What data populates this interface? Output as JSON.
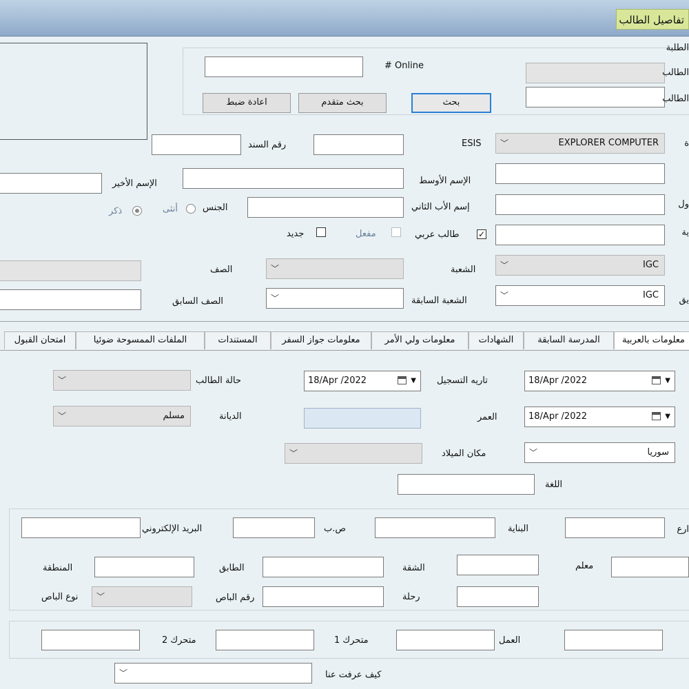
{
  "window": {
    "title": "تفاصيل الطالب"
  },
  "search": {
    "group_label": "الطلبة",
    "online_label": "# Online",
    "online_value": "",
    "student_no_label": "الطالب",
    "student_name_label": "الطالب",
    "search_button": "بحث",
    "advanced_search_button": "بحث متقدم",
    "reset_button": "اعادة ضبط"
  },
  "form": {
    "school_label": "ة",
    "school_value": "EXPLORER COMPUTER",
    "esis_label": "ESIS",
    "esis_value": "",
    "receipt_no_label": "رقم السند",
    "receipt_no_value": "",
    "first_name_label": "",
    "middle_name_label": "الإسم الأوسط",
    "last_name_label": "الإسم الأخير",
    "first_name_label_cut": "ول",
    "second_father_label": "إسم الأب الثاني",
    "gender_label": "الجنس",
    "gender_female": "أنثى",
    "gender_male": "ذكر",
    "nationality_label_cut": "ية",
    "arab_student_label": "طالب عربي",
    "active_label": "مفعل",
    "new_label": "جديد",
    "stream_label": "الشعبة",
    "curriculum_value": "IGC",
    "class_label": "الصف",
    "prev_stream_label": "الشعبة السابقة",
    "prev_curriculum_value": "IGC",
    "prev_curriculum_label_cut": "يق",
    "prev_class_label": "الصف السابق"
  },
  "tabs": [
    "معلومات بالعربية",
    "المدرسة السابقة",
    "الشهادات",
    "معلومات ولي الأمر",
    "معلومات جواز السفر",
    "المستندات",
    "الملفات الممسوحة ضوئيا",
    "امتحان القبول"
  ],
  "details": {
    "date1_value": "18/Apr /2022",
    "registration_date_label": "تاريه التسجيل",
    "registration_date_value": "18/Apr /2022",
    "student_status_label": "حالة الطالب",
    "dob_value": "18/Apr /2022",
    "age_label": "العمر",
    "religion_label": "الديانة",
    "religion_value": "مسلم",
    "country_value": "سوريا",
    "birthplace_label": "مكان الميلاد",
    "language_label": "اللغة"
  },
  "address": {
    "street_label_cut": "ارع",
    "building_label": "البناية",
    "po_box_label": "ص.ب",
    "email_label": "البريد الإلكتروني",
    "landmark_label": "معلم",
    "apartment_label": "الشقة",
    "floor_label": "الطابق",
    "area_label": "المنطقة",
    "trip_label": "رحلة",
    "bus_no_label": "رقم الباص",
    "bus_type_label": "نوع الباص"
  },
  "contact": {
    "work_label": "العمل",
    "mobile1_label": "متحرك 1",
    "mobile2_label": "متحرك 2",
    "how_heard_label": "كيف عرفت عنا"
  },
  "colors": {
    "accent": "#2a7fd4",
    "title_bg": "#d8e69a",
    "page_bg": "#e9f1f4"
  }
}
